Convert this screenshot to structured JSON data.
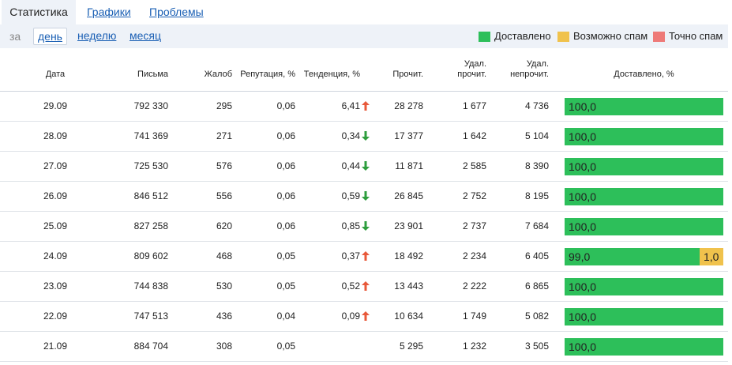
{
  "tabs": [
    {
      "label": "Статистика",
      "active": true
    },
    {
      "label": "Графики",
      "active": false
    },
    {
      "label": "Проблемы",
      "active": false
    }
  ],
  "period": {
    "label": "за",
    "options": [
      {
        "label": "день",
        "selected": true
      },
      {
        "label": "неделю",
        "selected": false
      },
      {
        "label": "месяц",
        "selected": false
      }
    ]
  },
  "legend": [
    {
      "label": "Доставлено",
      "color": "#2dbf5a"
    },
    {
      "label": "Возможно спам",
      "color": "#f0c24c"
    },
    {
      "label": "Точно спам",
      "color": "#ee7a78"
    }
  ],
  "columns": {
    "date": "Дата",
    "letters": "Письма",
    "complaints": "Жалоб",
    "reputation": "Репутация, %",
    "trend": "Тенденция, %",
    "read": "Прочит.",
    "deleted_read_1": "Удал.",
    "deleted_read_2": "прочит.",
    "deleted_unread_1": "Удал.",
    "deleted_unread_2": "непрочит.",
    "delivered": "Доставлено, %"
  },
  "colors": {
    "delivered": "#2dbf5a",
    "maybe_spam": "#f0c24c",
    "trend_up": "#e8593a",
    "trend_down": "#2e9e3e"
  },
  "rows": [
    {
      "date": "29.09",
      "letters": "792 330",
      "complaints": "295",
      "reputation": "0,06",
      "trend": "6,41",
      "trend_dir": "up",
      "read": "28 278",
      "deleted_read": "1 677",
      "deleted_unread": "4 736",
      "delivered": 100.0,
      "delivered_label": "100,0",
      "maybe_spam": 0,
      "maybe_spam_label": ""
    },
    {
      "date": "28.09",
      "letters": "741 369",
      "complaints": "271",
      "reputation": "0,06",
      "trend": "0,34",
      "trend_dir": "down",
      "read": "17 377",
      "deleted_read": "1 642",
      "deleted_unread": "5 104",
      "delivered": 100.0,
      "delivered_label": "100,0",
      "maybe_spam": 0,
      "maybe_spam_label": ""
    },
    {
      "date": "27.09",
      "letters": "725 530",
      "complaints": "576",
      "reputation": "0,06",
      "trend": "0,44",
      "trend_dir": "down",
      "read": "11 871",
      "deleted_read": "2 585",
      "deleted_unread": "8 390",
      "delivered": 100.0,
      "delivered_label": "100,0",
      "maybe_spam": 0,
      "maybe_spam_label": ""
    },
    {
      "date": "26.09",
      "letters": "846 512",
      "complaints": "556",
      "reputation": "0,06",
      "trend": "0,59",
      "trend_dir": "down",
      "read": "26 845",
      "deleted_read": "2 752",
      "deleted_unread": "8 195",
      "delivered": 100.0,
      "delivered_label": "100,0",
      "maybe_spam": 0,
      "maybe_spam_label": ""
    },
    {
      "date": "25.09",
      "letters": "827 258",
      "complaints": "620",
      "reputation": "0,06",
      "trend": "0,85",
      "trend_dir": "down",
      "read": "23 901",
      "deleted_read": "2 737",
      "deleted_unread": "7 684",
      "delivered": 100.0,
      "delivered_label": "100,0",
      "maybe_spam": 0,
      "maybe_spam_label": ""
    },
    {
      "date": "24.09",
      "letters": "809 602",
      "complaints": "468",
      "reputation": "0,05",
      "trend": "0,37",
      "trend_dir": "up",
      "read": "18 492",
      "deleted_read": "2 234",
      "deleted_unread": "6 405",
      "delivered": 99.0,
      "delivered_label": "99,0",
      "maybe_spam": 1.0,
      "maybe_spam_label": "1,0"
    },
    {
      "date": "23.09",
      "letters": "744 838",
      "complaints": "530",
      "reputation": "0,05",
      "trend": "0,52",
      "trend_dir": "up",
      "read": "13 443",
      "deleted_read": "2 222",
      "deleted_unread": "6 865",
      "delivered": 100.0,
      "delivered_label": "100,0",
      "maybe_spam": 0,
      "maybe_spam_label": ""
    },
    {
      "date": "22.09",
      "letters": "747 513",
      "complaints": "436",
      "reputation": "0,04",
      "trend": "0,09",
      "trend_dir": "up",
      "read": "10 634",
      "deleted_read": "1 749",
      "deleted_unread": "5 082",
      "delivered": 100.0,
      "delivered_label": "100,0",
      "maybe_spam": 0,
      "maybe_spam_label": ""
    },
    {
      "date": "21.09",
      "letters": "884 704",
      "complaints": "308",
      "reputation": "0,05",
      "trend": "",
      "trend_dir": "",
      "read": "5 295",
      "deleted_read": "1 232",
      "deleted_unread": "3 505",
      "delivered": 100.0,
      "delivered_label": "100,0",
      "maybe_spam": 0,
      "maybe_spam_label": ""
    }
  ]
}
